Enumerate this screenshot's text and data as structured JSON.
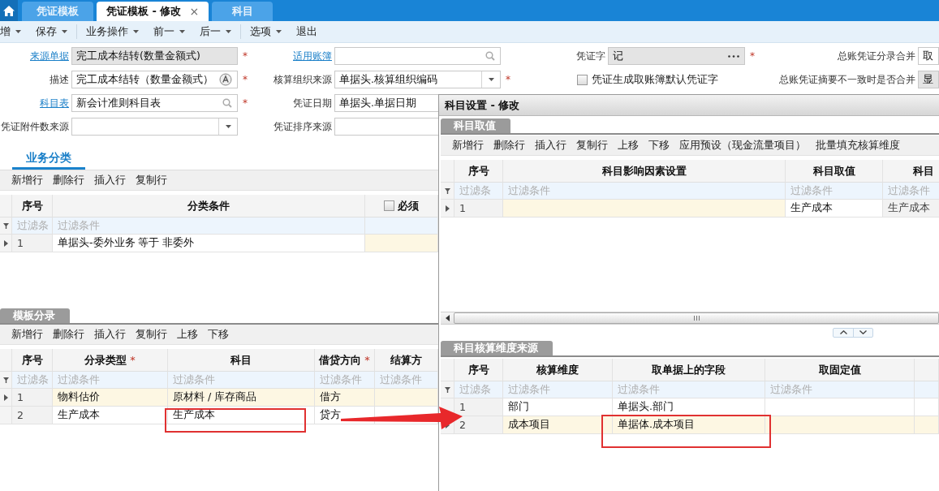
{
  "tabs": [
    {
      "label": "凭证模板",
      "selected": false
    },
    {
      "label": "凭证模板 - 修改",
      "selected": true,
      "close": "×"
    },
    {
      "label": "科目",
      "selected": false
    }
  ],
  "toolbar": {
    "groups": [
      {
        "items": [
          {
            "label": "增",
            "dropdown": true
          },
          {
            "label": "保存",
            "dropdown": true
          }
        ]
      },
      {
        "items": [
          {
            "label": "业务操作",
            "dropdown": true
          },
          {
            "label": "前一",
            "dropdown": true
          },
          {
            "label": "后一",
            "dropdown": true
          }
        ]
      },
      {
        "items": [
          {
            "label": "选项",
            "dropdown": true
          },
          {
            "label": "退出",
            "dropdown": false
          }
        ]
      }
    ]
  },
  "form": {
    "rows": [
      {
        "fields": [
          {
            "kind": "text",
            "label": "来源单据",
            "link": true,
            "value": "完工成本结转(数量金额式)",
            "disabled": true,
            "required_mark": "*"
          },
          {
            "kind": "search",
            "label": "适用账簿",
            "link": true,
            "disabled": false
          },
          {
            "kind": "ellipsis",
            "label": "凭证字",
            "link": false,
            "value": "记",
            "disabled": true,
            "required_mark": "*"
          },
          {
            "kind": "text",
            "label": "总账凭证分录合并",
            "link": false,
            "value": "取",
            "disabled": false
          }
        ]
      },
      {
        "fields": [
          {
            "kind": "translate",
            "label": "描述",
            "link": false,
            "value": "完工成本结转（数量金额式）",
            "disabled": false,
            "required_mark": "*"
          },
          {
            "kind": "dropdown",
            "label": "核算组织来源",
            "link": false,
            "value": "单据头.核算组织编码",
            "disabled": false,
            "required_mark": "*"
          },
          {
            "kind": "checkbox",
            "label": "凭证生成取账簿默认凭证字",
            "checked": false
          },
          {
            "kind": "text",
            "label": "总账凭证摘要不一致时是否合并",
            "link": false,
            "value": "显",
            "disabled": true
          }
        ]
      },
      {
        "fields": [
          {
            "kind": "search",
            "label": "科目表",
            "link": true,
            "value": "新会计准则科目表",
            "disabled": false,
            "required_mark": "*"
          },
          {
            "kind": "text",
            "label": "凭证日期",
            "link": false,
            "value": "单据头.单据日期",
            "disabled": false
          }
        ]
      },
      {
        "fields": [
          {
            "kind": "dropdown",
            "label": "凭证附件数来源",
            "link": false,
            "disabled": false
          },
          {
            "kind": "text",
            "label": "凭证排序来源",
            "link": false,
            "disabled": false
          }
        ]
      }
    ]
  },
  "business": {
    "tab": {
      "label": "业务分类",
      "kind": "underline"
    },
    "toolbar": [
      {
        "label": "新增行"
      },
      {
        "label": "删除行"
      },
      {
        "label": "插入行"
      },
      {
        "label": "复制行"
      }
    ],
    "grid": {
      "columns": [
        {
          "kind": "text",
          "label": "序号",
          "filter": "过滤条",
          "readonly": true,
          "editable": false
        },
        {
          "kind": "text",
          "label": "分类条件",
          "filter": "过滤条件",
          "readonly": false,
          "editable": false
        },
        {
          "kind": "checkbox",
          "label": "必须",
          "checked": false,
          "readonly": false,
          "editable": true
        }
      ],
      "rows": [
        {
          "selected": true,
          "highlighted": false,
          "cells": [
            "1",
            "单据头-委外业务  等于  非委外"
          ]
        }
      ]
    }
  },
  "entries": {
    "tab": {
      "label": "模板分录",
      "kind": "tab"
    },
    "toolbar": [
      {
        "label": "新增行"
      },
      {
        "label": "删除行"
      },
      {
        "label": "插入行"
      },
      {
        "label": "复制行"
      },
      {
        "label": "上移"
      },
      {
        "label": "下移"
      }
    ],
    "grid": {
      "columns": [
        {
          "kind": "text",
          "label": "序号",
          "filter": "过滤条",
          "readonly": true,
          "editable": false
        },
        {
          "kind": "text",
          "label": "分录类型",
          "required_mark": "*",
          "filter": "过滤条件",
          "readonly": false,
          "editable": false
        },
        {
          "kind": "text",
          "label": "科目",
          "filter": "过滤条件",
          "readonly": false,
          "editable": false
        },
        {
          "kind": "text",
          "label": "借贷方向",
          "required_mark": "*",
          "filter": "过滤条件",
          "readonly": false,
          "editable": false
        },
        {
          "kind": "text",
          "label": "结算方",
          "filter": "过滤条件",
          "readonly": false,
          "editable": false
        }
      ],
      "rows": [
        {
          "selected": true,
          "highlighted": true,
          "cells": [
            "1",
            "物料估价",
            "原材料  / 库存商品",
            "借方"
          ]
        },
        {
          "selected": false,
          "highlighted": false,
          "cells": [
            "2",
            "生产成本",
            "生产成本",
            "贷方"
          ]
        }
      ]
    }
  },
  "dialog": {
    "title": "科目设置 - 修改",
    "sections": [
      {
        "tab": {
          "label": "科目取值",
          "kind": "tab"
        },
        "toolbar": [
          {
            "label": "新增行"
          },
          {
            "label": "删除行"
          },
          {
            "label": "插入行"
          },
          {
            "label": "复制行"
          },
          {
            "label": "上移"
          },
          {
            "label": "下移"
          },
          {
            "label": "应用预设（现金流量项目）"
          },
          {
            "label": "批量填充核算维度"
          }
        ],
        "grid": {
          "columns": [
            {
              "kind": "text",
              "label": "序号",
              "filter": "过滤条",
              "readonly": true,
              "editable": false
            },
            {
              "kind": "text",
              "label": "科目影响因素设置",
              "filter": "过滤条件",
              "readonly": false,
              "editable": true
            },
            {
              "kind": "text",
              "label": "科目取值",
              "filter": "过滤条件",
              "readonly": false,
              "editable": false
            },
            {
              "kind": "text",
              "label": "科目",
              "filter": "过滤条件",
              "readonly": true,
              "editable": false
            }
          ],
          "rows": [
            {
              "selected": true,
              "highlighted": false,
              "cells": [
                "1",
                null,
                "生产成本",
                "生产成本"
              ]
            }
          ]
        }
      },
      {
        "tab": {
          "label": "科目核算维度来源",
          "kind": "tab"
        },
        "grid": {
          "columns": [
            {
              "kind": "text",
              "label": "序号",
              "filter": "过滤条",
              "readonly": true,
              "editable": false
            },
            {
              "kind": "text",
              "label": "核算维度",
              "filter": "过滤条件",
              "readonly": false,
              "editable": false
            },
            {
              "kind": "text",
              "label": "取单据上的字段",
              "filter": "过滤条件",
              "readonly": false,
              "editable": false
            },
            {
              "kind": "text",
              "label": "取固定值",
              "filter": "过滤条件",
              "readonly": false,
              "editable": false
            },
            {
              "kind": "text",
              "readonly": false,
              "editable": false
            }
          ],
          "rows": [
            {
              "selected": false,
              "highlighted": false,
              "cells": [
                "1",
                "部门",
                "单据头.部门"
              ]
            },
            {
              "selected": true,
              "highlighted": true,
              "cells": [
                "2",
                "成本项目",
                "单据体.成本项目"
              ]
            }
          ]
        }
      }
    ]
  },
  "annotations": [
    {
      "kind": "frame"
    },
    {
      "kind": "frame"
    },
    {
      "kind": "arrow"
    }
  ]
}
